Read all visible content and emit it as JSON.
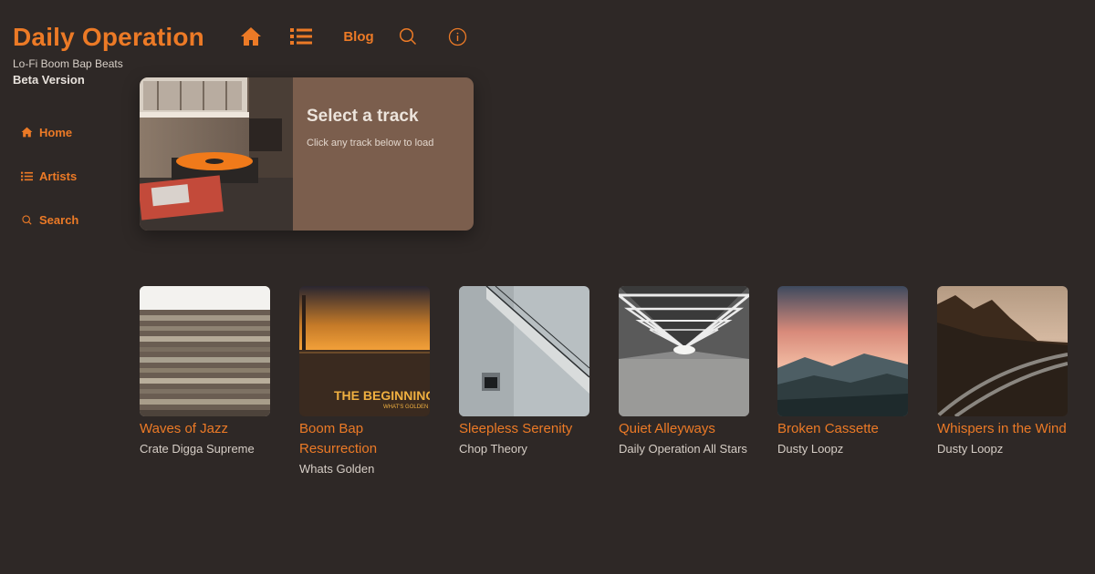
{
  "brand": {
    "title": "Daily Operation",
    "subtitle": "Lo-Fi Boom Bap Beats",
    "version": "Beta Version"
  },
  "topnav": {
    "home_icon": "home-icon",
    "list_icon": "list-icon",
    "blog_label": "Blog",
    "search_icon": "search-icon",
    "info_icon": "info-icon"
  },
  "sidebar": {
    "items": [
      {
        "label": "Home",
        "icon": "home-icon"
      },
      {
        "label": "Artists",
        "icon": "list-icon"
      },
      {
        "label": "Search",
        "icon": "search-icon"
      }
    ]
  },
  "player": {
    "title": "Select a track",
    "subtitle": "Click any track below to load"
  },
  "tracks": [
    {
      "title": "Waves of Jazz",
      "artist": "Crate Digga Supreme"
    },
    {
      "title": "Boom Bap Resurrection",
      "artist": "Whats Golden",
      "cover_text": "THE BEGINNING",
      "cover_subtext": "WHAT'S GOLDEN"
    },
    {
      "title": "Sleepless Serenity",
      "artist": "Chop Theory"
    },
    {
      "title": "Quiet Alleyways",
      "artist": "Daily Operation All Stars"
    },
    {
      "title": "Broken Cassette",
      "artist": "Dusty Loopz"
    },
    {
      "title": "Whispers in the Wind",
      "artist": "Dusty Loopz"
    }
  ],
  "colors": {
    "background": "#2e2826",
    "accent": "#ec7a26",
    "card": "#7b5e4d"
  }
}
